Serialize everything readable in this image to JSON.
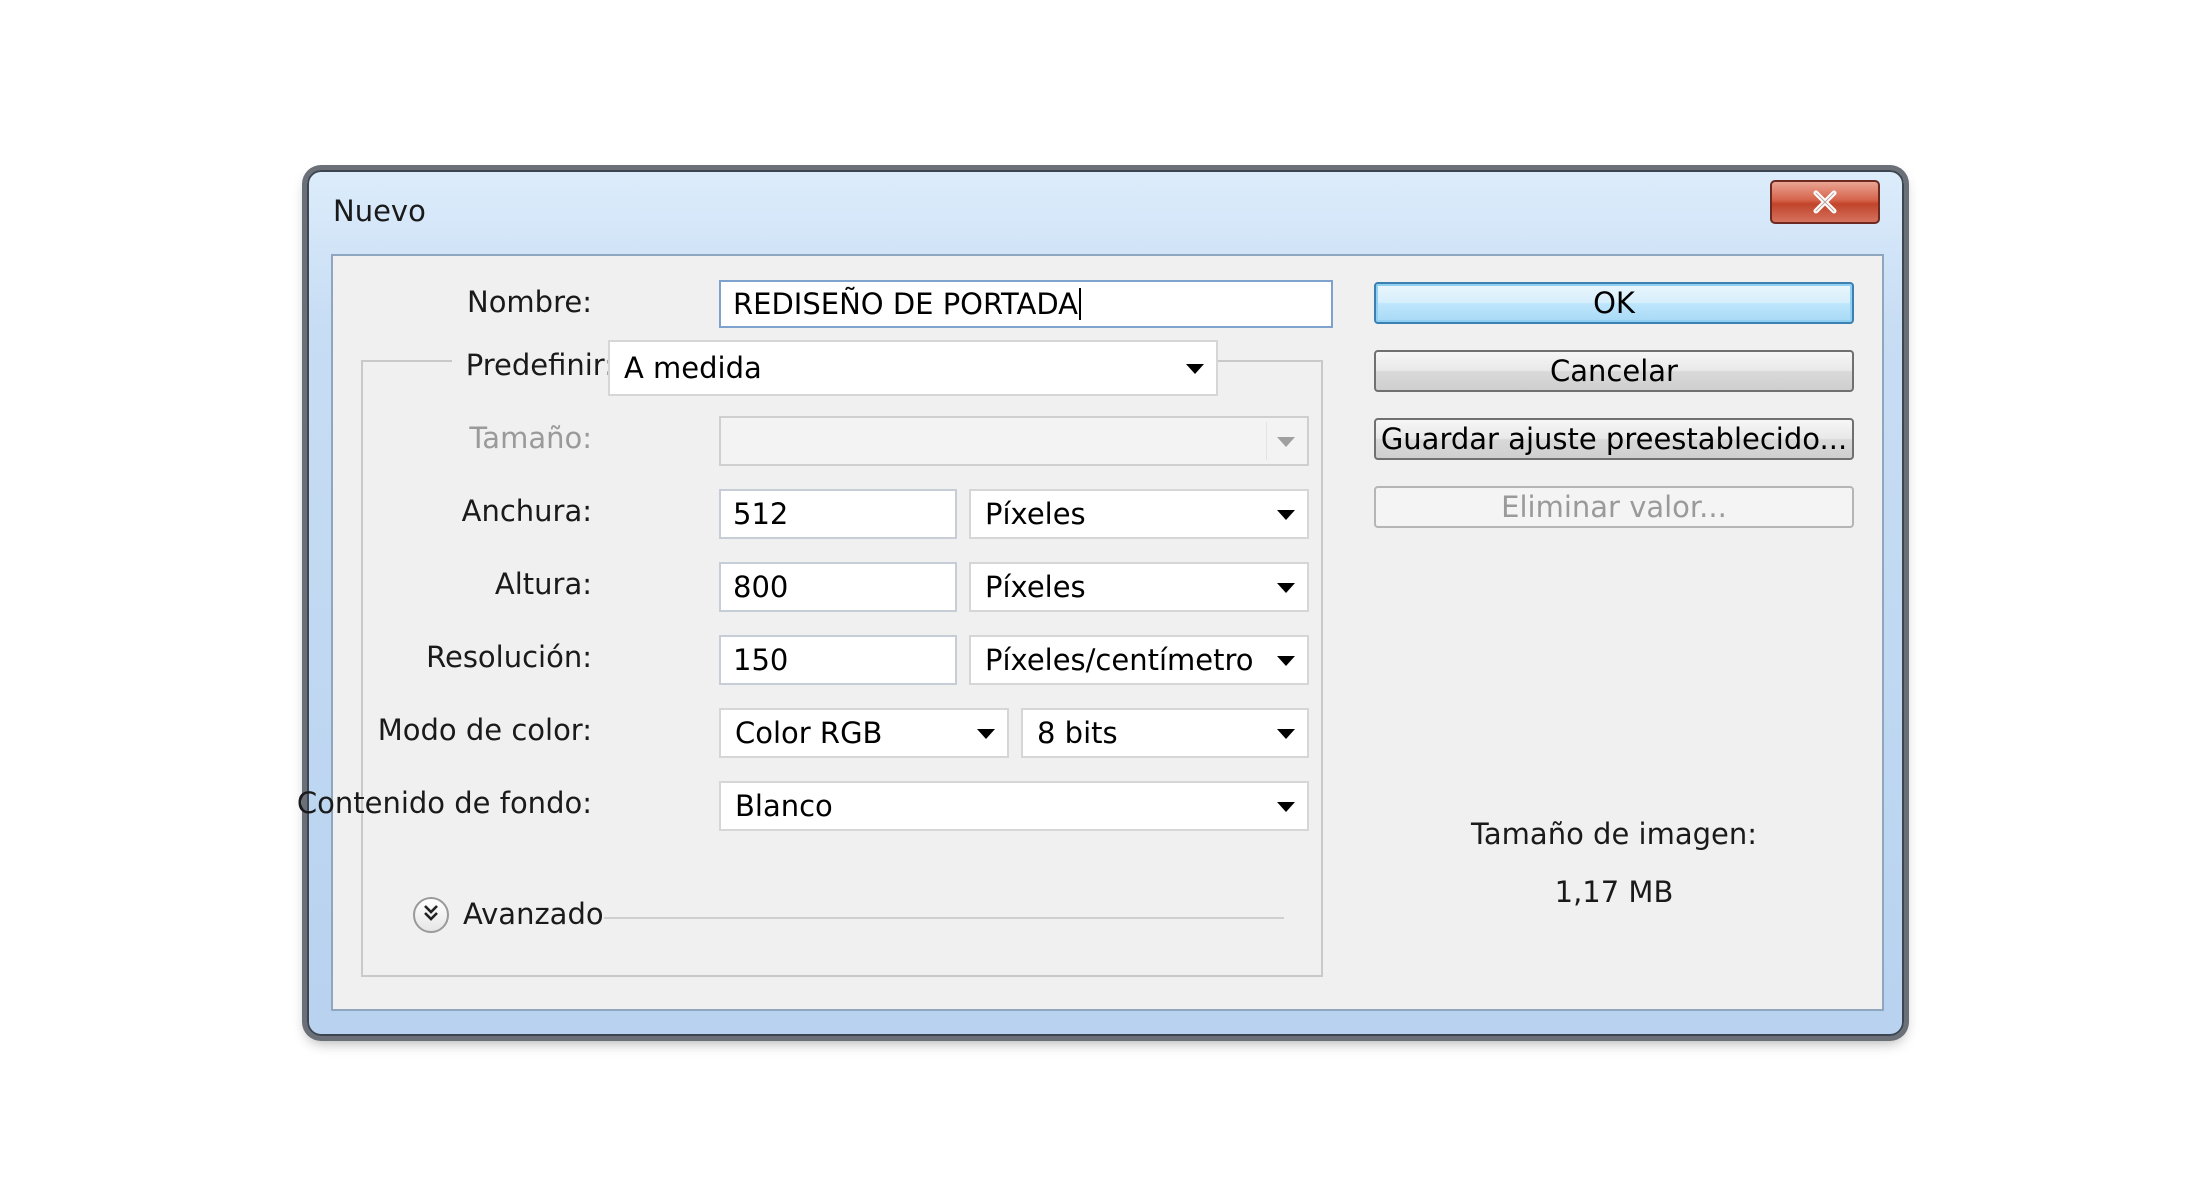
{
  "window": {
    "title": "Nuevo"
  },
  "form": {
    "nombre": {
      "label": "Nombre:",
      "value": "REDISEÑO DE PORTADA"
    },
    "predefinir": {
      "label": "Predefinir:",
      "value": "A medida"
    },
    "tamano": {
      "label": "Tamaño:",
      "value": ""
    },
    "anchura": {
      "label": "Anchura:",
      "value": "512",
      "unit": "Píxeles"
    },
    "altura": {
      "label": "Altura:",
      "value": "800",
      "unit": "Píxeles"
    },
    "resolucion": {
      "label": "Resolución:",
      "value": "150",
      "unit": "Píxeles/centímetro"
    },
    "modo_color": {
      "label": "Modo de color:",
      "value": "Color RGB",
      "bits": "8 bits"
    },
    "contenido_fondo": {
      "label": "Contenido de fondo:",
      "value": "Blanco"
    },
    "avanzado": {
      "label": "Avanzado"
    }
  },
  "buttons": {
    "ok": "OK",
    "cancel": "Cancelar",
    "save_preset": "Guardar ajuste preestablecido...",
    "delete_preset": "Eliminar valor..."
  },
  "image_size": {
    "label": "Tamaño de imagen:",
    "value": "1,17 MB"
  },
  "icons": {
    "close": "close-icon",
    "dropdown": "chevron-down-icon",
    "advanced": "double-chevron-down-icon"
  },
  "colors": {
    "title_bar": "#c7ddf4",
    "close_button": "#c1442b",
    "ok_button": "#bee6fd",
    "dialog_bg": "#f0f0f0"
  }
}
